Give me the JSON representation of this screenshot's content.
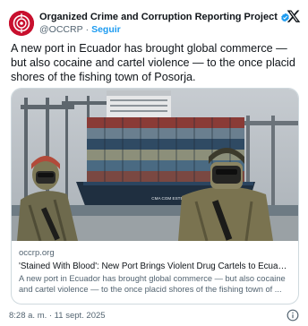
{
  "tweet": {
    "author_name": "Organized Crime and Corruption Reporting Project",
    "handle": "@OCCRP",
    "separator": "·",
    "follow_label": "Seguir",
    "text": "A new port in Ecuador has brought global commerce — but also cocaine and cartel violence — to the once placid shores of the fishing town of Posorja.",
    "timestamp": "8:28 a. m. · 11 sept. 2025"
  },
  "card": {
    "domain": "occrp.org",
    "title": "'Stained With Blood': New Port Brings Violent Drug Cartels to Ecuador Fi...",
    "description": "A new port in Ecuador has brought global commerce — but also cocaine and cartel violence — to the once placid shores of the fishing town of ...",
    "ship_name": "CMA CGM ESTELLE"
  },
  "icons": {
    "verified": "verified-badge-icon",
    "platform": "x-logo-icon",
    "info": "info-icon"
  },
  "colors": {
    "accent": "#1d9bf0",
    "brand": "#c8102e",
    "text": "#0f1419",
    "secondary": "#536471"
  }
}
